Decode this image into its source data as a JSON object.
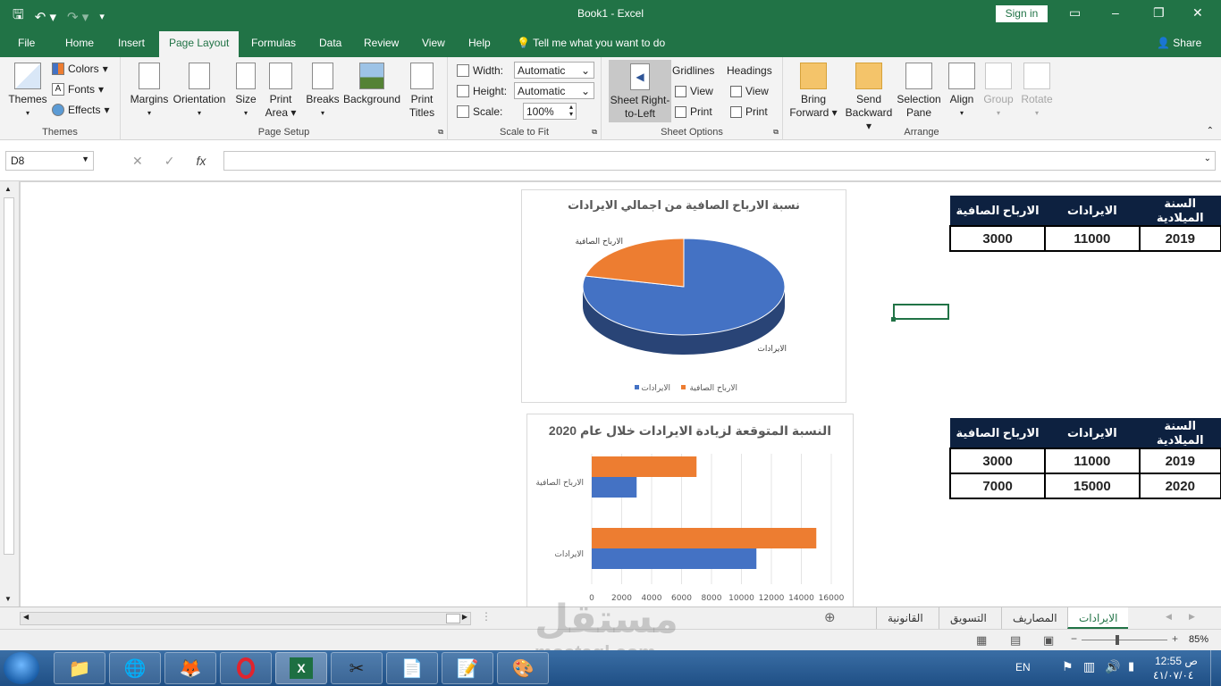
{
  "app": {
    "doc_title": "Book1  -  Excel",
    "signin_label": "Sign in"
  },
  "ribbon_tabs": [
    "File",
    "Home",
    "Insert",
    "Page Layout",
    "Formulas",
    "Data",
    "Review",
    "View",
    "Help"
  ],
  "active_tab": "Page Layout",
  "tell_me": "Tell me what you want to do",
  "share": "Share",
  "ribbon": {
    "themes": {
      "themes": "Themes",
      "colors": "Colors",
      "fonts": "Fonts",
      "effects": "Effects",
      "group": "Themes"
    },
    "page_setup": {
      "margins": "Margins",
      "orientation": "Orientation",
      "size": "Size",
      "print_area_1": "Print",
      "print_area_2": "Area",
      "breaks": "Breaks",
      "background": "Background",
      "print_titles_1": "Print",
      "print_titles_2": "Titles",
      "group": "Page Setup"
    },
    "scale": {
      "width_label": "Width:",
      "width_value": "Automatic",
      "height_label": "Height:",
      "height_value": "Automatic",
      "scale_label": "Scale:",
      "scale_value": "100%",
      "group": "Scale to Fit"
    },
    "sheet_options": {
      "rtl_1": "Sheet Right-",
      "rtl_2": "to-Left",
      "gridlines": "Gridlines",
      "headings": "Headings",
      "view": "View",
      "print": "Print",
      "group": "Sheet Options"
    },
    "arrange": {
      "bring_1": "Bring",
      "bring_2": "Forward",
      "send_1": "Send",
      "send_2": "Backward",
      "selection_1": "Selection",
      "selection_2": "Pane",
      "align": "Align",
      "group_btn": "Group",
      "rotate": "Rotate",
      "group": "Arrange"
    }
  },
  "formula_bar": {
    "name_box": "D8",
    "fx": "fx",
    "content": ""
  },
  "table1": {
    "headers": [
      "السنة الميلادية",
      "الايرادات",
      "الارباح الصافية"
    ],
    "rows": [
      [
        "2019",
        "11000",
        "3000"
      ]
    ]
  },
  "table2": {
    "headers": [
      "السنة الميلادية",
      "الايرادات",
      "الارباح الصافية"
    ],
    "rows": [
      [
        "2019",
        "11000",
        "3000"
      ],
      [
        "2020",
        "15000",
        "7000"
      ]
    ]
  },
  "chart_data": [
    {
      "type": "pie",
      "title": "نسبة الارباح الصافية من اجمالي الايرادات",
      "categories": [
        "الايرادات",
        "الارباح الصافية"
      ],
      "values": [
        11000,
        3000
      ],
      "colors": [
        "#4472C4",
        "#ED7D31"
      ],
      "legend": "bottom"
    },
    {
      "type": "bar",
      "orientation": "horizontal",
      "title": "النسبة المتوقعة لزيادة الايرادات خلال عام 2020",
      "categories": [
        "الايرادات",
        "الارباح الصافية"
      ],
      "series": [
        {
          "values": [
            11000,
            3000
          ],
          "color": "#4472C4"
        },
        {
          "values": [
            15000,
            7000
          ],
          "color": "#ED7D31"
        }
      ],
      "xlim": [
        0,
        16000
      ],
      "ticks": [
        "0",
        "2000",
        "4000",
        "6000",
        "8000",
        "10000",
        "12000",
        "14000",
        "16000"
      ],
      "grid": true
    }
  ],
  "sheet_tabs": [
    "الايرادات",
    "المصاريف",
    "التسويق",
    "القانونية"
  ],
  "active_sheet": "الايرادات",
  "status": {
    "zoom": "85%"
  },
  "taskbar": {
    "lang": "EN",
    "time": "12:55 ص",
    "date": "٤١/٠٧/٠٤"
  },
  "watermark": {
    "arabic": "مستقل",
    "latin": "mostaql.com"
  }
}
